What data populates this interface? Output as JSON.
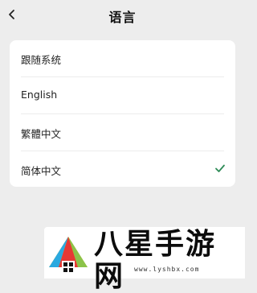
{
  "header": {
    "title": "语言",
    "back_icon": "chevron-left-icon"
  },
  "languages": [
    {
      "label": "跟随系统",
      "selected": false
    },
    {
      "label": "English",
      "selected": false
    },
    {
      "label": "繁體中文",
      "selected": false
    },
    {
      "label": "简体中文",
      "selected": true
    }
  ],
  "colors": {
    "background": "#ededed",
    "card": "#ffffff",
    "check": "#2e8b57"
  },
  "watermark": {
    "brand": "八星手游网",
    "url": "www.lyshbx.com"
  }
}
